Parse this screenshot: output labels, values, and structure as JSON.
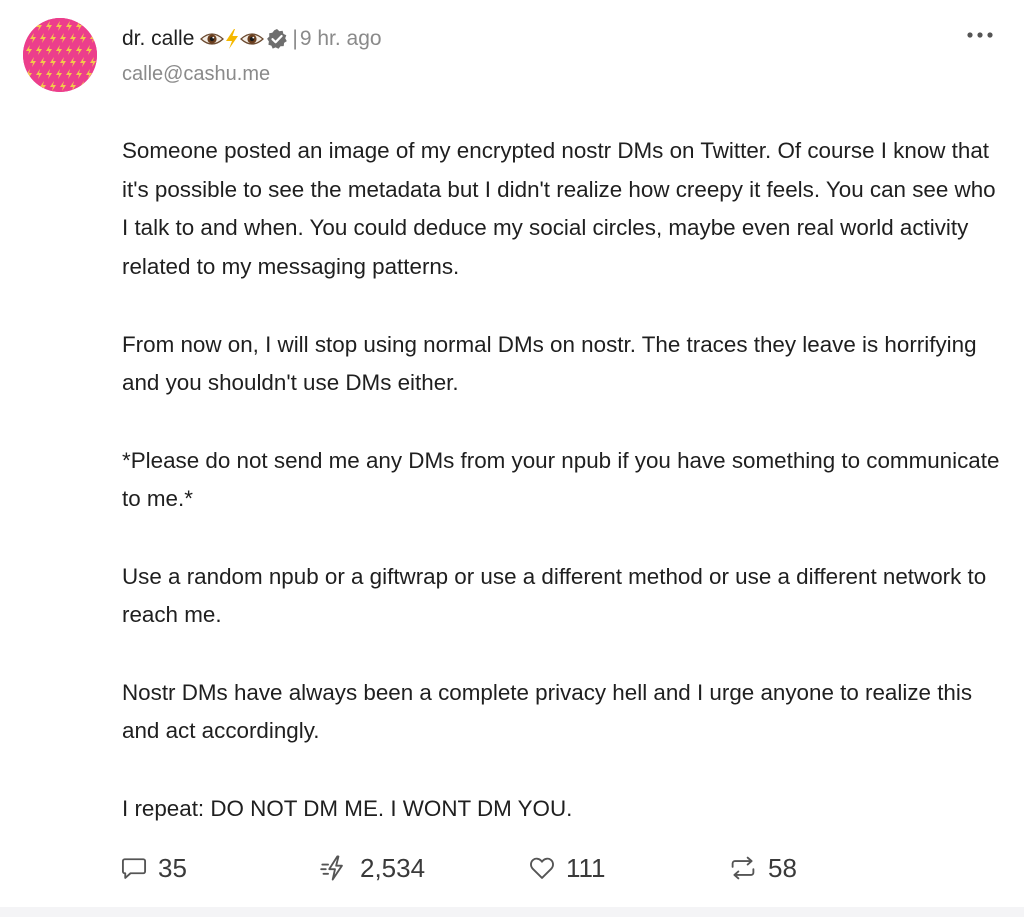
{
  "post": {
    "author": {
      "name": "dr. calle",
      "name_emojis": [
        "eye-icon",
        "lightning-icon",
        "eye-icon",
        "verified-badge-icon"
      ],
      "nip05": "calle@cashu.me",
      "avatar": {
        "background": "#ec3e8c",
        "pattern": "lightning-bolt-icon",
        "pattern_color": "#f2c94c"
      }
    },
    "separator": "|",
    "timestamp": "9 hr. ago",
    "menu_icon": "more-dots-icon",
    "content": [
      "Someone posted an image of my encrypted nostr DMs on Twitter. Of course I know that it's possible to see the metadata but I didn't realize how creepy it feels. You can see who I talk to and when. You could deduce my social circles, maybe even real world activity related to my messaging patterns.",
      "From now on, I will stop using normal DMs on nostr. The traces they leave is horrifying and you shouldn't use DMs either.",
      "*Please do not send me any DMs from your npub if you have something to communicate to me.*",
      "Use a random npub or a giftwrap or use a different method or use a different network to reach me.",
      "Nostr DMs have always been a complete privacy hell and I urge anyone to realize this and act accordingly.",
      "I repeat: DO NOT DM ME. I WONT DM YOU."
    ],
    "actions": {
      "replies": {
        "icon": "speech-bubble-icon",
        "count": "35"
      },
      "zaps": {
        "icon": "zap-icon",
        "count": "2,534"
      },
      "likes": {
        "icon": "heart-icon",
        "count": "111"
      },
      "reposts": {
        "icon": "repost-icon",
        "count": "58"
      }
    }
  }
}
